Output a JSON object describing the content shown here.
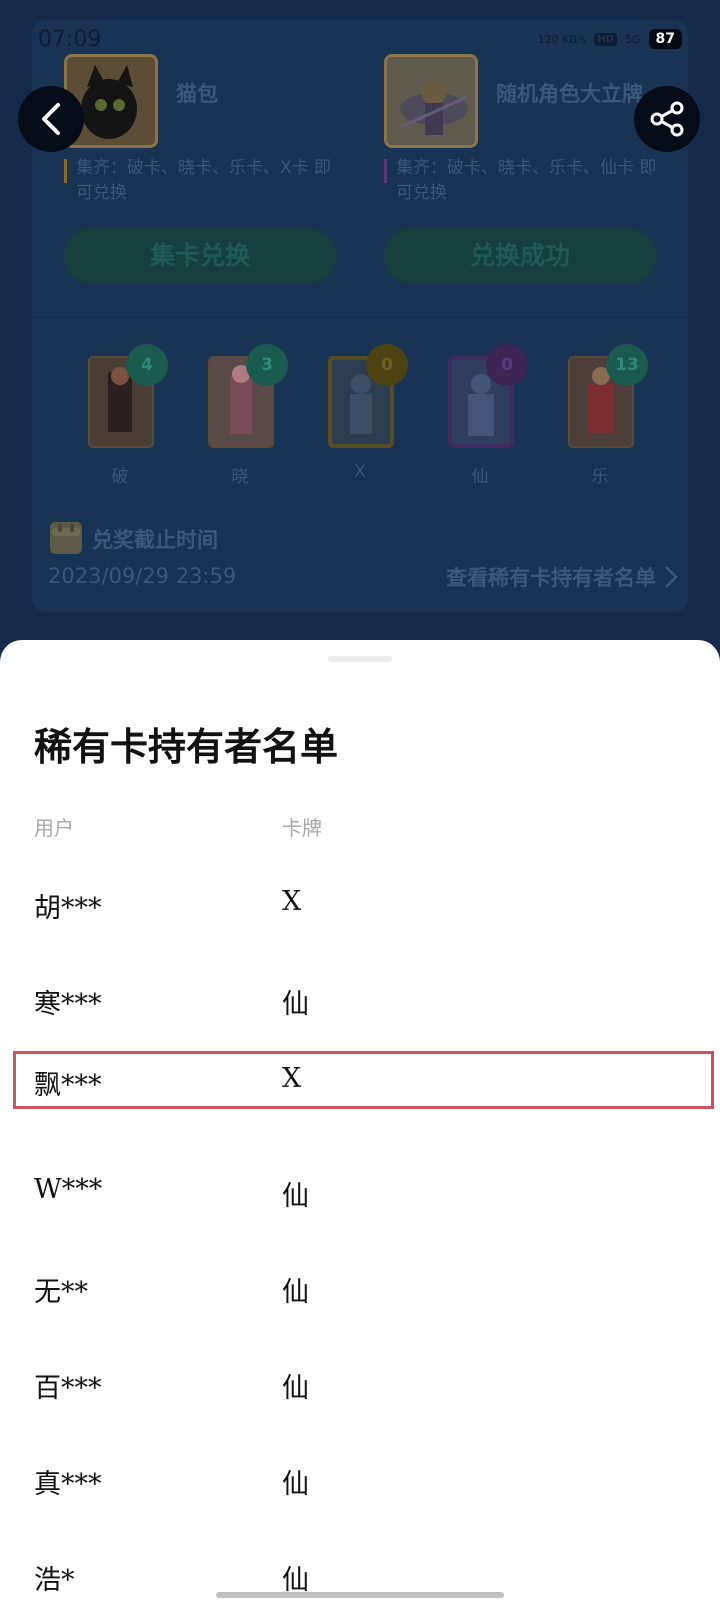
{
  "status_bar": {
    "time": "07:09",
    "network_speed": "120 KB/s",
    "hd_badge": "HD",
    "signal": "5G",
    "battery": "87"
  },
  "prizes": [
    {
      "name": "猫包",
      "requirement": "集齐：破卡、晓卡、乐卡、X卡 即可兑换",
      "button_label": "集卡兑换"
    },
    {
      "name": "随机角色大立牌",
      "requirement": "集齐：破卡、晓卡、乐卡、仙卡 即可兑换",
      "button_label": "兑换成功"
    }
  ],
  "cards": [
    {
      "label": "破",
      "count": "4"
    },
    {
      "label": "晓",
      "count": "3"
    },
    {
      "label": "X",
      "count": "0"
    },
    {
      "label": "仙",
      "count": "0"
    },
    {
      "label": "乐",
      "count": "13"
    }
  ],
  "deadline": {
    "label": "兑奖截止时间",
    "date": "2023/09/29 23:59"
  },
  "holders_link": "查看稀有卡持有者名单",
  "sheet": {
    "title": "稀有卡持有者名单",
    "col_user": "用户",
    "col_card": "卡牌",
    "rows": [
      {
        "user": "胡***",
        "card": "X"
      },
      {
        "user": "寒***",
        "card": "仙"
      },
      {
        "user": "飘***",
        "card": "X"
      },
      {
        "user": "W***",
        "card": "仙"
      },
      {
        "user": "无**",
        "card": "仙"
      },
      {
        "user": "百***",
        "card": "仙"
      },
      {
        "user": "真***",
        "card": "仙"
      },
      {
        "user": "浩*",
        "card": "仙"
      }
    ]
  },
  "icons": {
    "back": "chevron-left-icon",
    "share": "share-icon",
    "calendar": "calendar-icon",
    "chevron": "chevron-right-icon"
  }
}
